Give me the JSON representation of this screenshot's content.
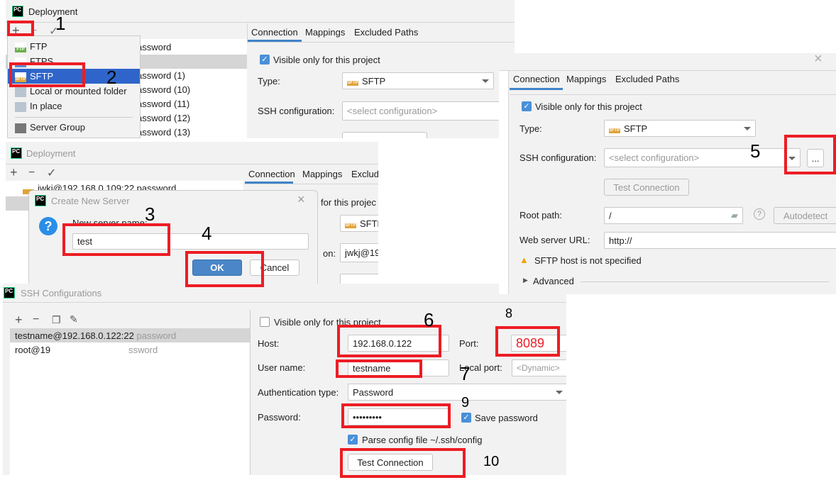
{
  "panel_a": {
    "title": "Deployment",
    "toolbar": [
      "+",
      "−",
      "✓"
    ],
    "menu": [
      {
        "label": "FTP",
        "icon": "ftp-icon"
      },
      {
        "label": "FTPS",
        "icon": "ftps-icon"
      },
      {
        "label": "SFTP",
        "icon": "sftp-icon",
        "selected": true
      },
      {
        "label": "Local or mounted folder",
        "icon": "folder-network-icon"
      },
      {
        "label": "In place",
        "icon": "home-icon"
      },
      {
        "label": "Server Group",
        "icon": "server-group-icon"
      }
    ],
    "list": [
      "assword",
      "",
      "assword (1)",
      "assword (10)",
      "assword (11)",
      "assword (12)",
      "assword (13)"
    ],
    "tabs": [
      "Connection",
      "Mappings",
      "Excluded Paths"
    ],
    "visible_label": "Visible only for this project",
    "type_label": "Type:",
    "type_value": "SFTP",
    "ssh_label": "SSH configuration:",
    "ssh_placeholder": "<select configuration>"
  },
  "panel_b": {
    "title": "Deployment",
    "toolbar": [
      "+",
      "−",
      "✓"
    ],
    "list_first": "jwkj@192.168.0.109:22 password",
    "tabs": [
      "Connection",
      "Mappings",
      "Exclud"
    ],
    "visible_fragment": "for this projec",
    "type_value": "SFTP",
    "ssh_label_fragment": "on:",
    "ssh_value": "jwkj@19",
    "dialog": {
      "title": "Create New Server",
      "prompt": "New server name:",
      "value": "test",
      "ok": "OK",
      "cancel": "Cancel"
    }
  },
  "panel_c": {
    "tabs": [
      "Connection",
      "Mappings",
      "Excluded Paths"
    ],
    "visible_label": "Visible only for this project",
    "type_label": "Type:",
    "type_value": "SFTP",
    "ssh_label": "SSH configuration:",
    "ssh_placeholder": "<select configuration>",
    "browse": "...",
    "test_connection": "Test Connection",
    "root_label": "Root path:",
    "root_value": "/",
    "autodetect": "Autodetect",
    "web_label": "Web server URL:",
    "web_value": "http://",
    "warning": "SFTP host is not specified",
    "advanced": "Advanced",
    "warning_color": "#f0a30a"
  },
  "panel_d": {
    "title": "SSH Configurations",
    "toolbar": [
      "+",
      "−"
    ],
    "list": [
      {
        "name": "testname@192.168.0.122:22",
        "auth": "password"
      },
      {
        "name": "root@19",
        "auth": "ssword"
      }
    ],
    "visible_label": "Visible only for this project",
    "host_label": "Host:",
    "host_value": "192.168.0.122",
    "port_label": "Port:",
    "port_value": "8089",
    "port_color": "#ed1c24",
    "user_label": "User name:",
    "user_value": "testname",
    "local_port_label": "Local port:",
    "local_port_placeholder": "<Dynamic>",
    "auth_label": "Authentication type:",
    "auth_value": "Password",
    "password_label": "Password:",
    "password_value": "•••••••••",
    "save_password": "Save password",
    "parse_config": "Parse config file ~/.ssh/config",
    "test_connection": "Test Connection"
  },
  "annotations": [
    "1",
    "2",
    "3",
    "4",
    "5",
    "6",
    "7",
    "8",
    "9",
    "10"
  ],
  "accent": "#2f65ca",
  "highlight_color": "#ed1c24"
}
